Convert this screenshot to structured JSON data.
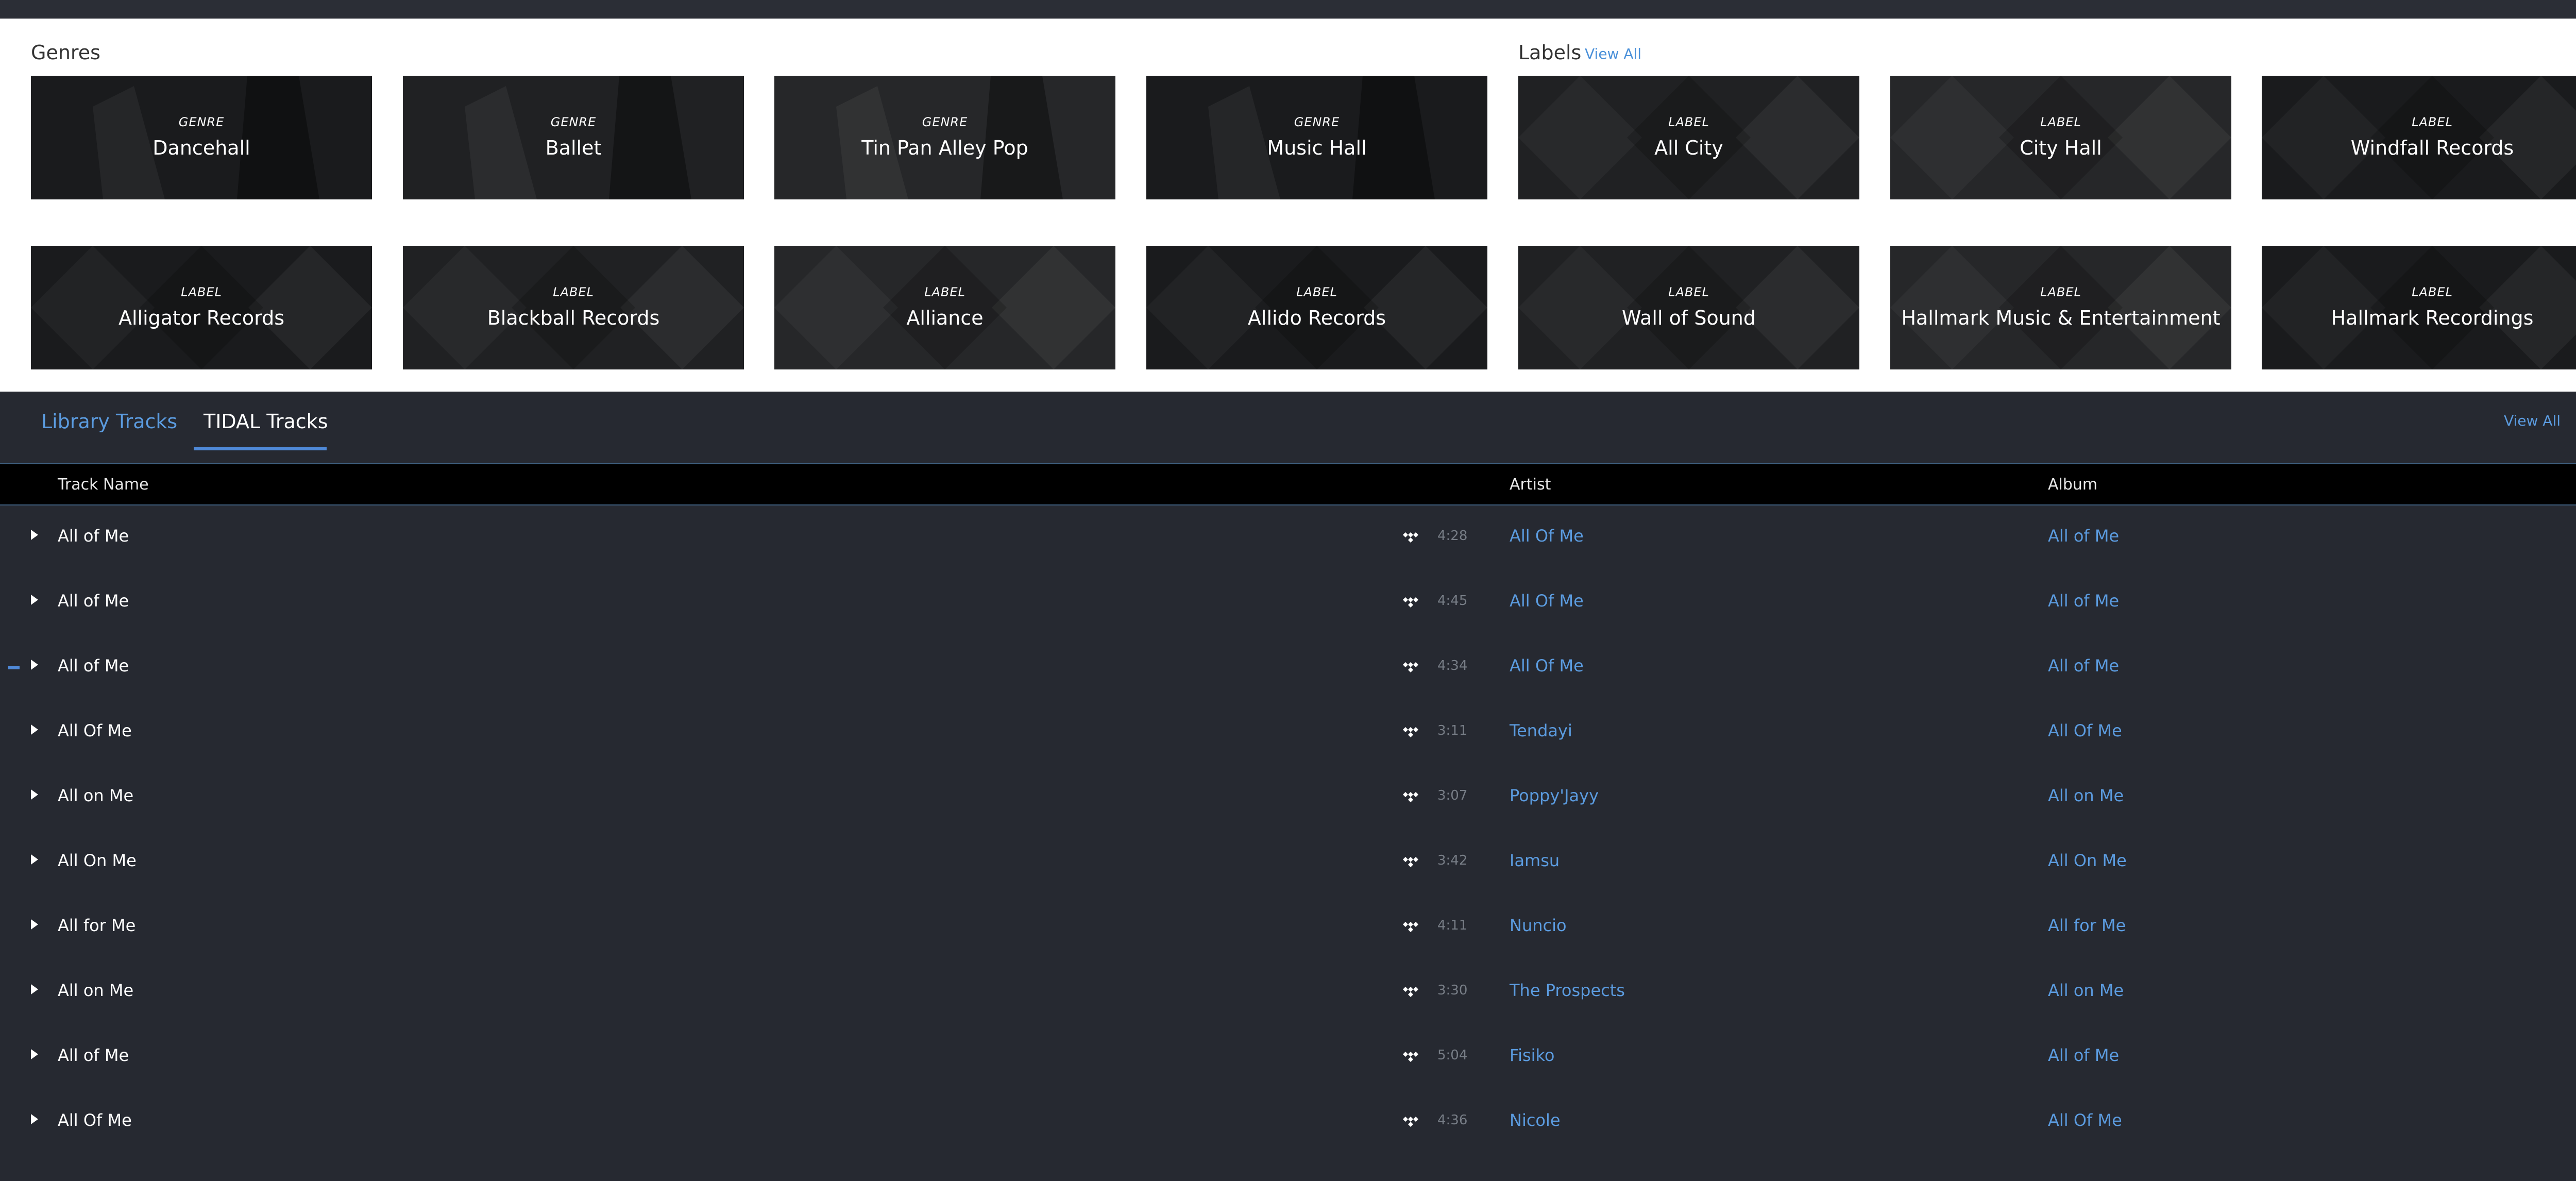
{
  "sections": {
    "genres_title": "Genres",
    "labels_title": "Labels",
    "labels_view_all": "View All"
  },
  "tiles_row1": [
    {
      "kind": "GENRE",
      "name": "Dancehall"
    },
    {
      "kind": "GENRE",
      "name": "Ballet"
    },
    {
      "kind": "GENRE",
      "name": "Tin Pan Alley Pop"
    },
    {
      "kind": "GENRE",
      "name": "Music Hall"
    },
    {
      "kind": "LABEL",
      "name": "All City"
    },
    {
      "kind": "LABEL",
      "name": "City Hall"
    },
    {
      "kind": "LABEL",
      "name": "Windfall Records"
    }
  ],
  "tiles_row2": [
    {
      "kind": "LABEL",
      "name": "Alligator Records"
    },
    {
      "kind": "LABEL",
      "name": "Blackball Records"
    },
    {
      "kind": "LABEL",
      "name": "Alliance"
    },
    {
      "kind": "LABEL",
      "name": "Allido Records"
    },
    {
      "kind": "LABEL",
      "name": "Wall of Sound"
    },
    {
      "kind": "LABEL",
      "name": "Hallmark Music & Entertainment"
    },
    {
      "kind": "LABEL",
      "name": "Hallmark Recordings"
    }
  ],
  "tabs": {
    "library": "Library Tracks",
    "tidal": "TIDAL Tracks",
    "view_all": "View All"
  },
  "table": {
    "col_track": "Track Name",
    "col_artist": "Artist",
    "col_album": "Album",
    "rows": [
      {
        "track": "All of Me",
        "duration": "4:28",
        "artist": "All Of Me",
        "album": "All of Me"
      },
      {
        "track": "All of Me",
        "duration": "4:45",
        "artist": "All Of Me",
        "album": "All of Me"
      },
      {
        "track": "All of Me",
        "duration": "4:34",
        "artist": "All Of Me",
        "album": "All of Me"
      },
      {
        "track": "All Of Me",
        "duration": "3:11",
        "artist": "Tendayi",
        "album": "All Of Me"
      },
      {
        "track": "All on Me",
        "duration": "3:07",
        "artist": "Poppy'Jayy",
        "album": "All on Me"
      },
      {
        "track": "All On Me",
        "duration": "3:42",
        "artist": "Iamsu",
        "album": "All On Me"
      },
      {
        "track": "All for Me",
        "duration": "4:11",
        "artist": "Nuncio",
        "album": "All for Me"
      },
      {
        "track": "All on Me",
        "duration": "3:30",
        "artist": "The Prospects",
        "album": "All on Me"
      },
      {
        "track": "All of Me",
        "duration": "5:04",
        "artist": "Fisiko",
        "album": "All of Me"
      },
      {
        "track": "All Of Me",
        "duration": "4:36",
        "artist": "Nicole",
        "album": "All Of Me"
      }
    ]
  },
  "colors": {
    "accent": "#5b9bdf",
    "background": "#262931",
    "header": "#000000"
  }
}
